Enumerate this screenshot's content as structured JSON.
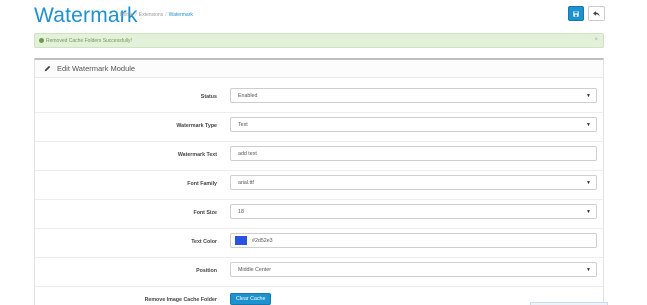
{
  "header": {
    "title": "Watermark",
    "breadcrumb": [
      "Home",
      "Extensions",
      "Watermark"
    ],
    "breadcrumb_sep": "/"
  },
  "alert": {
    "message": "Removed Cache Folders Successfully!",
    "close": "×",
    "color": "#e3f0da"
  },
  "panel": {
    "heading": "Edit Watermark Module"
  },
  "form": {
    "status": {
      "label": "Status",
      "value": "Enabled"
    },
    "watermark_type": {
      "label": "Watermark Type",
      "value": "Text"
    },
    "watermark_text": {
      "label": "Watermark Text",
      "value": "add text"
    },
    "font_family": {
      "label": "Font Family",
      "value": "arial.ttf"
    },
    "font_size": {
      "label": "Font Size",
      "value": "18"
    },
    "text_color": {
      "label": "Text Color",
      "value": "#2d52e3"
    },
    "position": {
      "label": "Position",
      "value": "Middle Center"
    },
    "remove_cache": {
      "label": "Remove Image Cache Folder",
      "button": "Clear Cache"
    }
  },
  "caret": "▼",
  "colors": {
    "accent": "#1e91cf",
    "swatch": "#2d52e3"
  },
  "icons": [
    "save-icon",
    "back-arrow-icon",
    "check-circle-icon",
    "pencil-icon",
    "caret-down-icon"
  ]
}
